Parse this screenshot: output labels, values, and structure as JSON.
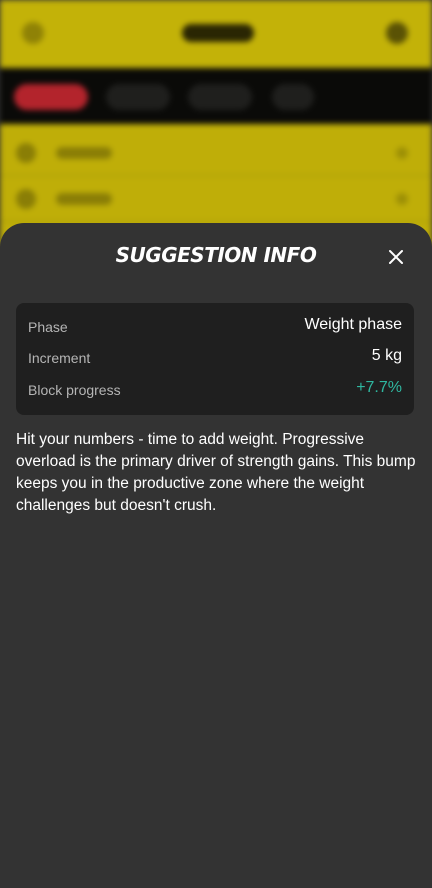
{
  "sheet": {
    "title": "SUGGESTION INFO",
    "close_icon": "close-icon"
  },
  "info": {
    "rows": [
      {
        "label": "Phase",
        "value": "Weight phase"
      },
      {
        "label": "Increment",
        "value": "5 kg"
      },
      {
        "label": "Block progress",
        "value": "+7.7%"
      }
    ]
  },
  "description": "Hit your numbers - time to add weight. Progressive overload is the primary driver of strength gains. This bump keeps you in the productive zone where the weight challenges but doesn't crush.",
  "colors": {
    "sheet_bg": "#333333",
    "card_bg": "#1f1f1f",
    "positive": "#2fb7a0",
    "background_accent": "#c3b208",
    "active_tab": "#b3242c"
  }
}
